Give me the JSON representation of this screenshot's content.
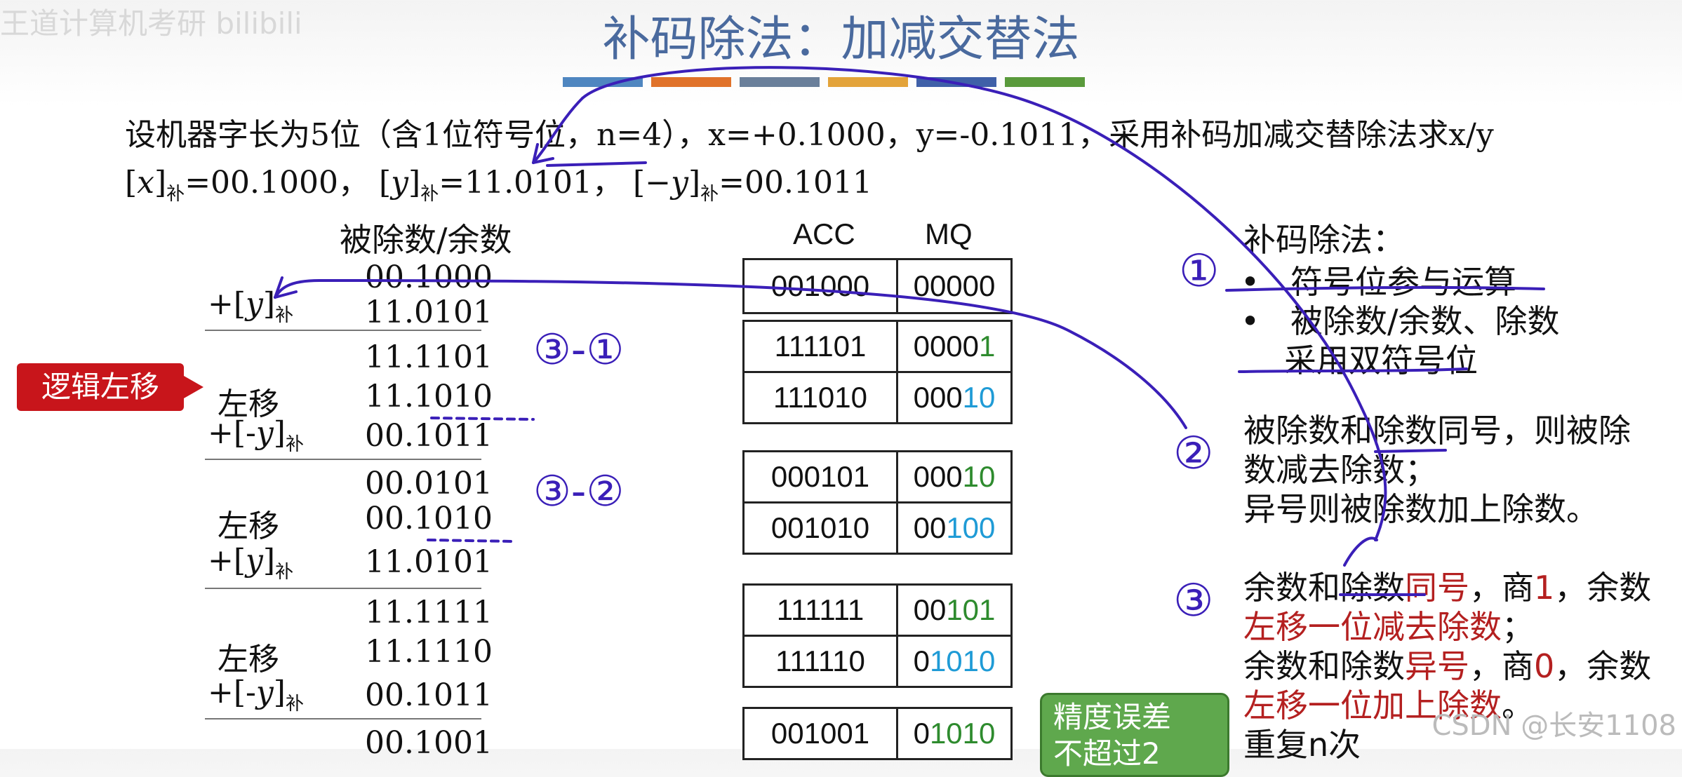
{
  "watermark_top": "王道计算机考研  bilibili",
  "title": "补码除法：加减交替法",
  "title_bar_colors": [
    "#4f86c0",
    "#e0722a",
    "#6a7f9a",
    "#e3a33a",
    "#3f60a8",
    "#5a9a3c"
  ],
  "problem": {
    "line1": "设机器字长为5位（含1位符号位，n=4），x=+0.1000，y=-0.1011，采用补码加减交替除法求x/y",
    "x_comp": "=00.1000，",
    "y_comp": "=11.0101，",
    "neg_y_comp": "=00.1011",
    "sub_label": "补"
  },
  "left_table": {
    "header": "被除数/余数",
    "ops": [
      "+[y]补",
      "左移",
      "+[-y]补",
      "左移",
      "+[y]补",
      "左移",
      "+[-y]补"
    ],
    "values": [
      "00.1000",
      "11.0101",
      "11.1101",
      "11.1010",
      "00.1011",
      "00.0101",
      "00.1010",
      "11.0101",
      "11.1111",
      "11.1110",
      "00.1011",
      "00.1001"
    ]
  },
  "tag_logic_shift": "逻辑左移",
  "register_table": {
    "acc_header": "ACC",
    "mq_header": "MQ",
    "rows": [
      {
        "acc": "001000",
        "mq_black": "00000",
        "mq_color": ""
      },
      {
        "acc": "111101",
        "mq_black": "0000",
        "mq_color": "1"
      },
      {
        "acc": "111010",
        "mq_black": "000",
        "mq_color": "10"
      },
      {
        "acc": "000101",
        "mq_black": "000",
        "mq_color": "10"
      },
      {
        "acc": "001010",
        "mq_black": "00",
        "mq_color": "100"
      },
      {
        "acc": "111111",
        "mq_black": "00",
        "mq_color": "101"
      },
      {
        "acc": "111110",
        "mq_black": "0",
        "mq_color": "1010"
      },
      {
        "acc": "001001",
        "mq_black": "0",
        "mq_color": "1010"
      }
    ]
  },
  "notes": {
    "heading": "补码除法：",
    "bullet1": "符号位参与运算",
    "bullet2a": "被除数/余数、除数",
    "bullet2b": "采用双符号位",
    "rule1a": "被除数和除数同号，则被除",
    "rule1b": "数减去除数；",
    "rule1c": "异号则被除数加上除数。",
    "rule2a_pre": "余数和除数",
    "rule2a_red1": "同号",
    "rule2a_mid": "，商",
    "rule2a_red2": "1",
    "rule2a_post": "，余数",
    "rule2b": "左移一位减去除数",
    "rule2b_post": "；",
    "rule3a_pre": "余数和除数",
    "rule3a_red1": "异号",
    "rule3a_mid": "，商",
    "rule3a_red2": "0",
    "rule3a_post": "，余数",
    "rule3b": "左移一位加上除数",
    "rule3b_post": "。",
    "rule4": "重复n次"
  },
  "tag_precision": "精度误差\n不超过2",
  "handwritten": [
    "①",
    "②",
    "③",
    "③-①",
    "③-②"
  ],
  "watermark_bottom": "CSDN @长安1108",
  "ink_color": "#3a1fb8"
}
